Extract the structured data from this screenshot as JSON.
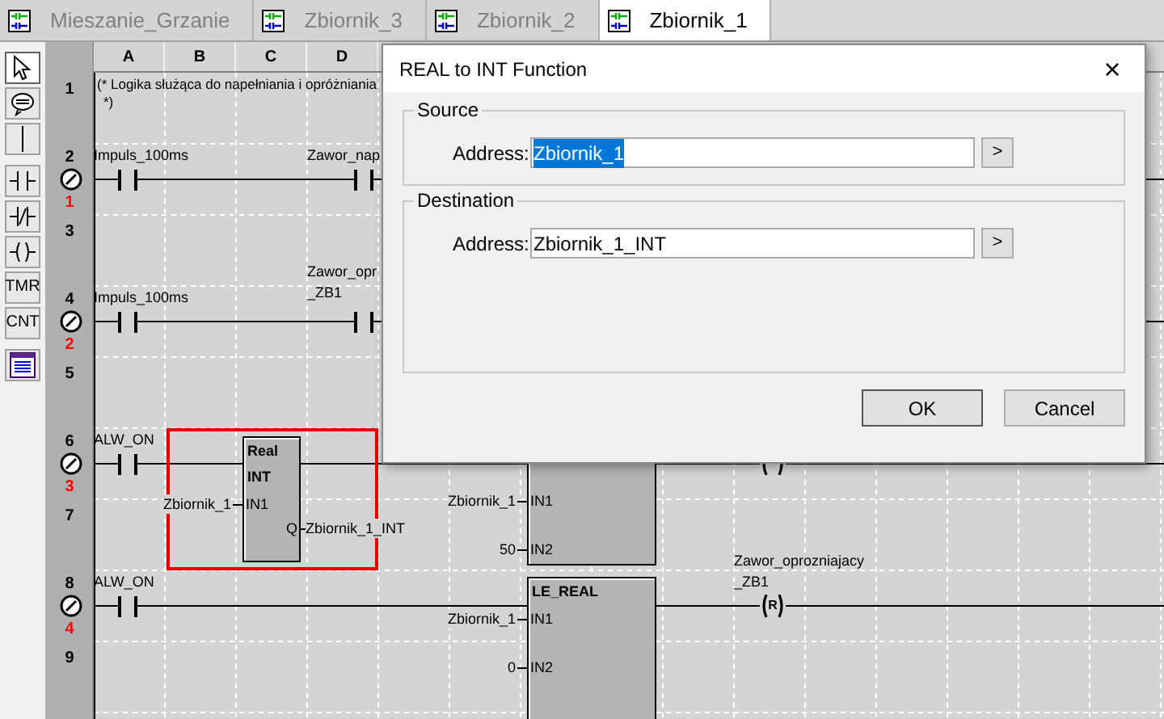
{
  "tabs": [
    {
      "label": "Mieszanie_Grzanie",
      "selected": false
    },
    {
      "label": "Zbiornik_3",
      "selected": false
    },
    {
      "label": "Zbiornik_2",
      "selected": false
    },
    {
      "label": "Zbiornik_1",
      "selected": true
    }
  ],
  "toolbar": [
    {
      "kind": "pointer",
      "selected": true
    },
    {
      "kind": "comment",
      "selected": false
    },
    {
      "kind": "line",
      "selected": false
    },
    {
      "kind": "contact",
      "selected": false
    },
    {
      "kind": "contact_nc",
      "selected": false
    },
    {
      "kind": "coil",
      "selected": false
    },
    {
      "kind": "text",
      "label": "TMR",
      "selected": false
    },
    {
      "kind": "text",
      "label": "CNT",
      "selected": false
    },
    {
      "kind": "table",
      "selected": false
    }
  ],
  "columns": [
    "A",
    "B",
    "C",
    "D"
  ],
  "rows": [
    {
      "number": "1"
    },
    {
      "number": "2",
      "step": "1"
    },
    {
      "number": "3"
    },
    {
      "number": "4",
      "step": "2"
    },
    {
      "number": "5"
    },
    {
      "number": "6",
      "step": "3"
    },
    {
      "number": "7"
    },
    {
      "number": "8",
      "step": "4"
    },
    {
      "number": "9"
    }
  ],
  "comment": [
    "(* Logika służąca do napełniania i opróżniania",
    "*)"
  ],
  "elements": [
    {
      "kind": "contact",
      "label": [
        "Impuls_100ms"
      ]
    },
    {
      "kind": "contact",
      "label": [
        "Zawor_nap"
      ]
    },
    {
      "kind": "contact",
      "label": [
        "Impuls_100ms"
      ]
    },
    {
      "kind": "contact",
      "label": [
        "Zawor_opr",
        "_ZB1"
      ]
    },
    {
      "kind": "contact",
      "label": [
        "ALW_ON"
      ]
    },
    {
      "kind": "block",
      "selected": true,
      "title": [
        "Real",
        "INT"
      ],
      "inputs": [
        {
          "pin": "IN1",
          "wire": "Zbiornik_1"
        }
      ],
      "output": {
        "pin": "Q",
        "wire": "Zbiornik_1_INT"
      }
    },
    {
      "kind": "block",
      "selected": false,
      "inputs": [
        {
          "pin": "IN1",
          "wire": "Zbiornik_1"
        },
        {
          "pin": "IN2",
          "wire": "50"
        }
      ]
    },
    {
      "kind": "coil"
    },
    {
      "kind": "contact",
      "label": [
        "ALW_ON"
      ]
    },
    {
      "kind": "block",
      "selected": false,
      "title": [
        "LE_REAL"
      ],
      "inputs": [
        {
          "pin": "IN1",
          "wire": "Zbiornik_1"
        },
        {
          "pin": "IN2",
          "wire": "0"
        }
      ]
    },
    {
      "kind": "coil",
      "label": [
        "Zawor_oprozniajacy",
        "_ZB1"
      ],
      "letter": "R"
    }
  ],
  "dialog": {
    "title": "REAL to INT Function",
    "close": "×",
    "groups": [
      {
        "title": "Source",
        "label": "Address:",
        "value": "Zbiornik_1",
        "highlighted": true,
        "browse": ">"
      },
      {
        "title": "Destination",
        "label": "Address:",
        "value": "Zbiornik_1_INT",
        "highlighted": false,
        "browse": ">"
      }
    ],
    "buttons": [
      "OK",
      "Cancel"
    ]
  }
}
